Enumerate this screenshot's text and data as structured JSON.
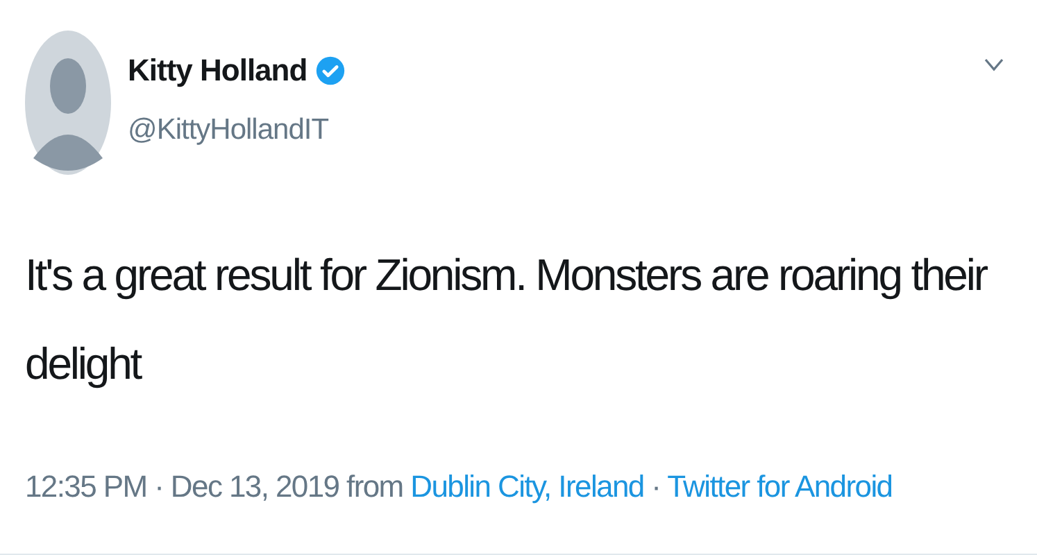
{
  "author": {
    "name": "Kitty Holland",
    "handle": "@KittyHollandIT",
    "verified": true
  },
  "text": "It's a great result for Zionism. Monsters are roaring their delight",
  "meta": {
    "timestamp": "12:35 PM · Dec 13, 2019 from",
    "location": "Dublin City, Ireland",
    "separator": "·",
    "source": "Twitter for Android"
  }
}
